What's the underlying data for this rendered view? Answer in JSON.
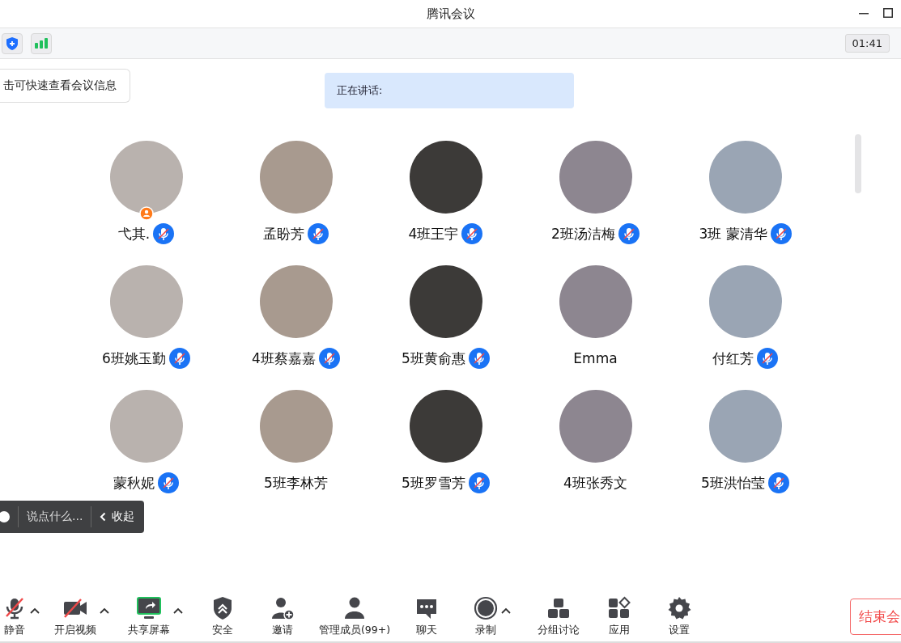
{
  "window": {
    "title": "腾讯会议"
  },
  "top_bar": {
    "timer": "01:41"
  },
  "meeting_info_tip": "击可快速查看会议信息",
  "speaking_banner": {
    "label": "正在讲话:"
  },
  "participants": [
    {
      "name": "弋其.",
      "muted": true,
      "host": true
    },
    {
      "name": "孟盼芳",
      "muted": true,
      "host": false
    },
    {
      "name": "4班王宇",
      "muted": true,
      "host": false
    },
    {
      "name": "2班汤洁梅",
      "muted": true,
      "host": false
    },
    {
      "name": "3班 蒙清华",
      "muted": true,
      "host": false
    },
    {
      "name": "6班姚玉勤",
      "muted": true,
      "host": false
    },
    {
      "name": "4班蔡嘉嘉",
      "muted": true,
      "host": false
    },
    {
      "name": "5班黄俞惠",
      "muted": true,
      "host": false
    },
    {
      "name": "Emma",
      "muted": false,
      "host": false
    },
    {
      "name": "付红芳",
      "muted": true,
      "host": false
    },
    {
      "name": "蒙秋妮",
      "muted": true,
      "host": false
    },
    {
      "name": "5班李林芳",
      "muted": false,
      "host": false
    },
    {
      "name": "5班罗雪芳",
      "muted": true,
      "host": false
    },
    {
      "name": "4班张秀文",
      "muted": false,
      "host": false
    },
    {
      "name": "5班洪怡莹",
      "muted": true,
      "host": false
    }
  ],
  "chat_bar": {
    "placeholder": "说点什么...",
    "collapse": "收起"
  },
  "toolbar": [
    {
      "kind": "mic",
      "label": "静音",
      "caret": true
    },
    {
      "kind": "video",
      "label": "开启视频",
      "caret": true
    },
    {
      "kind": "share",
      "label": "共享屏幕",
      "caret": true
    },
    {
      "kind": "security",
      "label": "安全",
      "caret": false
    },
    {
      "kind": "invite",
      "label": "邀请",
      "caret": false
    },
    {
      "kind": "members",
      "label": "管理成员(99+)",
      "caret": false
    },
    {
      "kind": "chat",
      "label": "聊天",
      "caret": false
    },
    {
      "kind": "record",
      "label": "录制",
      "caret": true
    },
    {
      "kind": "breakout",
      "label": "分组讨论",
      "caret": false
    },
    {
      "kind": "apps",
      "label": "应用",
      "caret": false
    },
    {
      "kind": "settings",
      "label": "设置",
      "caret": false
    }
  ],
  "end_button": "结束会"
}
